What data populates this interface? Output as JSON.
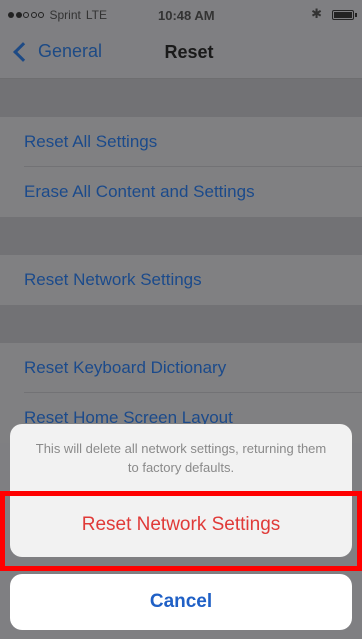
{
  "status_bar": {
    "carrier": "Sprint",
    "network": "LTE",
    "time": "10:48 AM",
    "bluetooth_icon": "bluetooth-icon",
    "battery_icon": "battery-icon"
  },
  "nav": {
    "back_label": "General",
    "title": "Reset"
  },
  "list": {
    "items": [
      "Reset All Settings",
      "Erase All Content and Settings",
      "Reset Network Settings",
      "Reset Keyboard Dictionary",
      "Reset Home Screen Layout"
    ]
  },
  "action_sheet": {
    "message": "This will delete all network settings, returning them to factory defaults.",
    "destructive_label": "Reset Network Settings",
    "cancel_label": "Cancel"
  },
  "colors": {
    "link_blue": "#1b4a8b",
    "destructive_red": "#e03a38",
    "highlight_red": "#ff0000",
    "cancel_blue": "#1f60c6"
  }
}
